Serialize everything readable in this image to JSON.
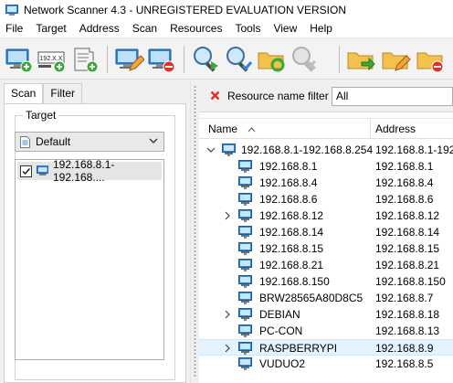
{
  "window": {
    "title": "Network Scanner 4.3 - UNREGISTERED EVALUATION VERSION"
  },
  "menu": [
    "File",
    "Target",
    "Address",
    "Scan",
    "Resources",
    "Tools",
    "View",
    "Help"
  ],
  "toolbar": {
    "buttons": [
      "add-computer-icon",
      "add-ip-range-icon",
      "add-from-file-icon",
      "edit-computer-icon",
      "remove-computer-icon",
      "scan-icon",
      "scan-selected-icon",
      "refresh-folder-icon",
      "stop-scan-icon",
      "export-folder-icon",
      "edit-folder-icon",
      "delete-folder-icon"
    ],
    "ip_icon_text": "192.X.X"
  },
  "left_panel": {
    "tabs": [
      "Scan",
      "Filter"
    ],
    "active_tab": "Scan",
    "group_label": "Target",
    "profile_value": "Default",
    "target_item": {
      "label": "192.168.8.1-192.168....",
      "checked": true
    }
  },
  "right_panel": {
    "filter_label": "Resource name filter",
    "filter_value": "All",
    "columns": {
      "name": "Name",
      "address": "Address"
    },
    "root": {
      "name": "192.168.8.1-192.168.8.254",
      "address": "192.168.8.1-192.1"
    },
    "rows": [
      {
        "name": "192.168.8.1",
        "address": "192.168.8.1",
        "expandable": false,
        "selected": false
      },
      {
        "name": "192.168.8.4",
        "address": "192.168.8.4",
        "expandable": false,
        "selected": false
      },
      {
        "name": "192.168.8.6",
        "address": "192.168.8.6",
        "expandable": false,
        "selected": false
      },
      {
        "name": "192.168.8.12",
        "address": "192.168.8.12",
        "expandable": true,
        "selected": false
      },
      {
        "name": "192.168.8.14",
        "address": "192.168.8.14",
        "expandable": false,
        "selected": false
      },
      {
        "name": "192.168.8.15",
        "address": "192.168.8.15",
        "expandable": false,
        "selected": false
      },
      {
        "name": "192.168.8.21",
        "address": "192.168.8.21",
        "expandable": false,
        "selected": false
      },
      {
        "name": "192.168.8.150",
        "address": "192.168.8.150",
        "expandable": false,
        "selected": false
      },
      {
        "name": "BRW28565A80D8C5",
        "address": "192.168.8.7",
        "expandable": false,
        "selected": false
      },
      {
        "name": "DEBIAN",
        "address": "192.168.8.18",
        "expandable": true,
        "selected": false
      },
      {
        "name": "PC-CON",
        "address": "192.168.8.13",
        "expandable": false,
        "selected": false
      },
      {
        "name": "RASPBERRYPI",
        "address": "192.168.8.9",
        "expandable": true,
        "selected": true
      },
      {
        "name": "VUDUO2",
        "address": "192.168.8.5",
        "expandable": false,
        "selected": false
      }
    ]
  },
  "colors": {
    "accent": "#0078d7",
    "selection": "#e5f3ff",
    "error_red": "#e0302b",
    "add_green": "#3aa935",
    "folder_yellow": "#f2c14e"
  }
}
